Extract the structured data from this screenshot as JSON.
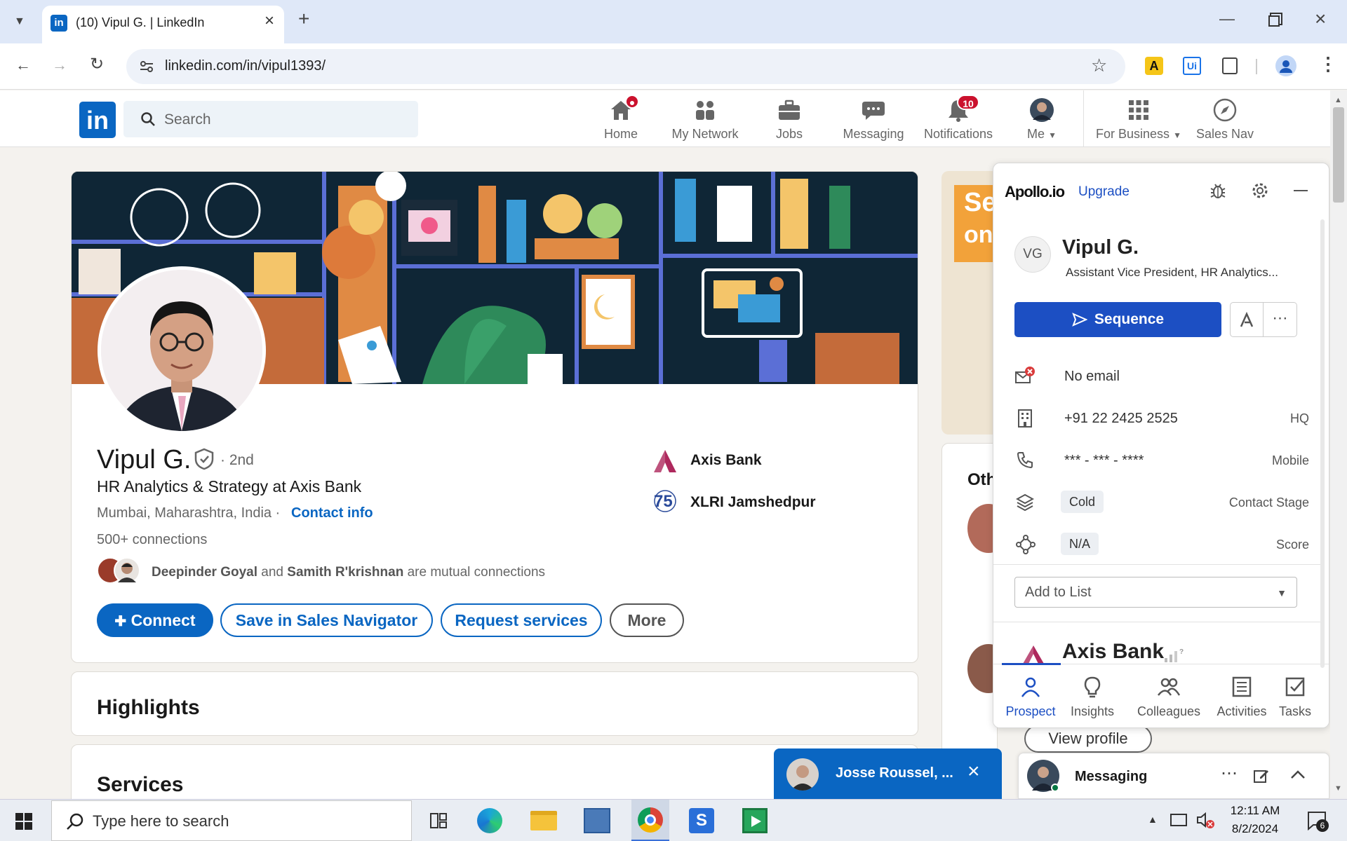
{
  "browser": {
    "tab_title": "(10) Vipul G. | LinkedIn",
    "new_tab": "+",
    "url": "linkedin.com/in/vipul1393/"
  },
  "linkedin_nav": {
    "logo": "in",
    "search_placeholder": "Search",
    "items": [
      {
        "label": "Home",
        "icon": "home-icon"
      },
      {
        "label": "My Network",
        "icon": "network-icon"
      },
      {
        "label": "Jobs",
        "icon": "briefcase-icon"
      },
      {
        "label": "Messaging",
        "icon": "chat-icon"
      },
      {
        "label": "Notifications",
        "icon": "bell-icon",
        "badge": "10"
      },
      {
        "label": "Me",
        "icon": "avatar"
      },
      {
        "label": "For Business",
        "icon": "grid-icon"
      },
      {
        "label": "Sales Nav",
        "icon": "compass-icon"
      }
    ]
  },
  "profile": {
    "name": "Vipul G.",
    "degree": "· 2nd",
    "headline": "HR Analytics & Strategy at Axis Bank",
    "location": "Mumbai, Maharashtra, India ·",
    "contact_info": "Contact info",
    "connections": "500+ connections",
    "mutual_1": "Deepinder Goyal",
    "mutual_and": "and",
    "mutual_2": "Samith R'krishnan",
    "mutual_suffix": "are mutual connections",
    "company": "Axis Bank",
    "school": "XLRI Jamshedpur",
    "buttons": {
      "connect": "Connect",
      "save_sales_nav": "Save in Sales Navigator",
      "request_services": "Request services",
      "more": "More"
    }
  },
  "sections": {
    "highlights": "Highlights",
    "services": "Services"
  },
  "right_column": {
    "ad_text_1": "Se",
    "ad_text_2": "on",
    "others_heading": "Oth",
    "view_profile": "View profile"
  },
  "apollo": {
    "logo": "Apollo.io",
    "upgrade": "Upgrade",
    "initials": "VG",
    "name": "Vipul G.",
    "title": "Assistant Vice President, HR Analytics...",
    "sequence_button": "Sequence",
    "email": "No email",
    "phone": "+91 22 2425 2525",
    "phone_type": "HQ",
    "mobile": "*** - *** - ****",
    "mobile_type": "Mobile",
    "stage": "Cold",
    "stage_label": "Contact Stage",
    "score": "N/A",
    "score_label": "Score",
    "add_to_list": "Add to List",
    "company": "Axis Bank",
    "tabs": [
      "Prospect",
      "Insights",
      "Colleagues",
      "Activities",
      "Tasks"
    ]
  },
  "messaging": {
    "chat_name": "Josse Roussel, ...",
    "bar_label": "Messaging"
  },
  "taskbar": {
    "search_placeholder": "Type here to search",
    "time": "12:11 AM",
    "date": "8/2/2024",
    "notif_count": "6"
  },
  "colors": {
    "linkedin_blue": "#0a66c2",
    "apollo_blue": "#1c4fc3",
    "badge_red": "#cb112d"
  }
}
